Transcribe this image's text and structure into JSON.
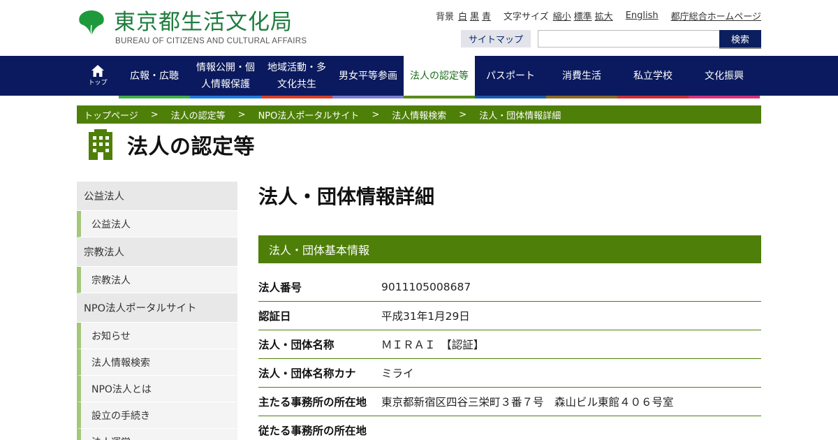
{
  "header": {
    "logo_ja": "東京都生活文化局",
    "logo_en": "BUREAU OF CITIZENS AND CULTURAL AFFAIRS",
    "bg_label": "背景",
    "bg_white": "白",
    "bg_black": "黒",
    "bg_blue": "青",
    "font_label": "文字サイズ",
    "font_small": "縮小",
    "font_standard": "標準",
    "font_large": "拡大",
    "english": "English",
    "tokyo_home": "都庁総合ホームページ",
    "sitemap": "サイトマップ",
    "search_placeholder": "",
    "search_button": "検索"
  },
  "nav": {
    "home_label": "トップ",
    "items": [
      {
        "line1": "広報・広聴",
        "line2": "",
        "accent": "#3fae4b"
      },
      {
        "line1": "情報公開・個",
        "line2": "人情報保護",
        "accent": "#1d7bd8"
      },
      {
        "line1": "地域活動・多",
        "line2": "文化共生",
        "accent": "#d6402a"
      },
      {
        "line1": "男女平等参画",
        "line2": "",
        "accent": "#7a7fd2"
      },
      {
        "line1": "法人の認定等",
        "line2": "",
        "accent": "#5a8a1a"
      },
      {
        "line1": "パスポート",
        "line2": "",
        "accent": "#1b5aa8"
      },
      {
        "line1": "消費生活",
        "line2": "",
        "accent": "#8a6a2a"
      },
      {
        "line1": "私立学校",
        "line2": "",
        "accent": "#c7303a"
      },
      {
        "line1": "文化振興",
        "line2": "",
        "accent": "#d6337a"
      }
    ]
  },
  "breadcrumb": [
    "トップページ",
    "法人の認定等",
    "NPO法人ポータルサイト",
    "法人情報検索",
    "法人・団体情報詳細"
  ],
  "breadcrumb_sep": ">",
  "page_title": "法人の認定等",
  "side": {
    "groups": [
      {
        "title": "公益法人",
        "items": [
          "公益法人"
        ]
      },
      {
        "title": "宗教法人",
        "items": [
          "宗教法人"
        ]
      },
      {
        "title": "NPO法人ポータルサイト",
        "items": [
          "お知らせ",
          "法人情報検索",
          "NPO法人とは",
          "設立の手続き",
          "法人運営"
        ]
      }
    ]
  },
  "main": {
    "title": "法人・団体情報詳細",
    "section": "法人・団体基本情報",
    "rows": [
      {
        "key": "法人番号",
        "value": "9011105008687"
      },
      {
        "key": "認証日",
        "value": "平成31年1月29日"
      },
      {
        "key": "法人・団体名称",
        "value": "ＭＩＲＡＩ　【認証】"
      },
      {
        "key": "法人・団体名称カナ",
        "value": "ミライ"
      },
      {
        "key": "主たる事務所の所在地",
        "value": "東京都新宿区四谷三栄町３番７号　森山ビル東館４０６号室"
      },
      {
        "key": "従たる事務所の所在地",
        "value": ""
      }
    ]
  },
  "colors": {
    "nav_bg": "#0b1a5e",
    "green": "#4e7f08",
    "logo_green": "#1e7d3e"
  }
}
